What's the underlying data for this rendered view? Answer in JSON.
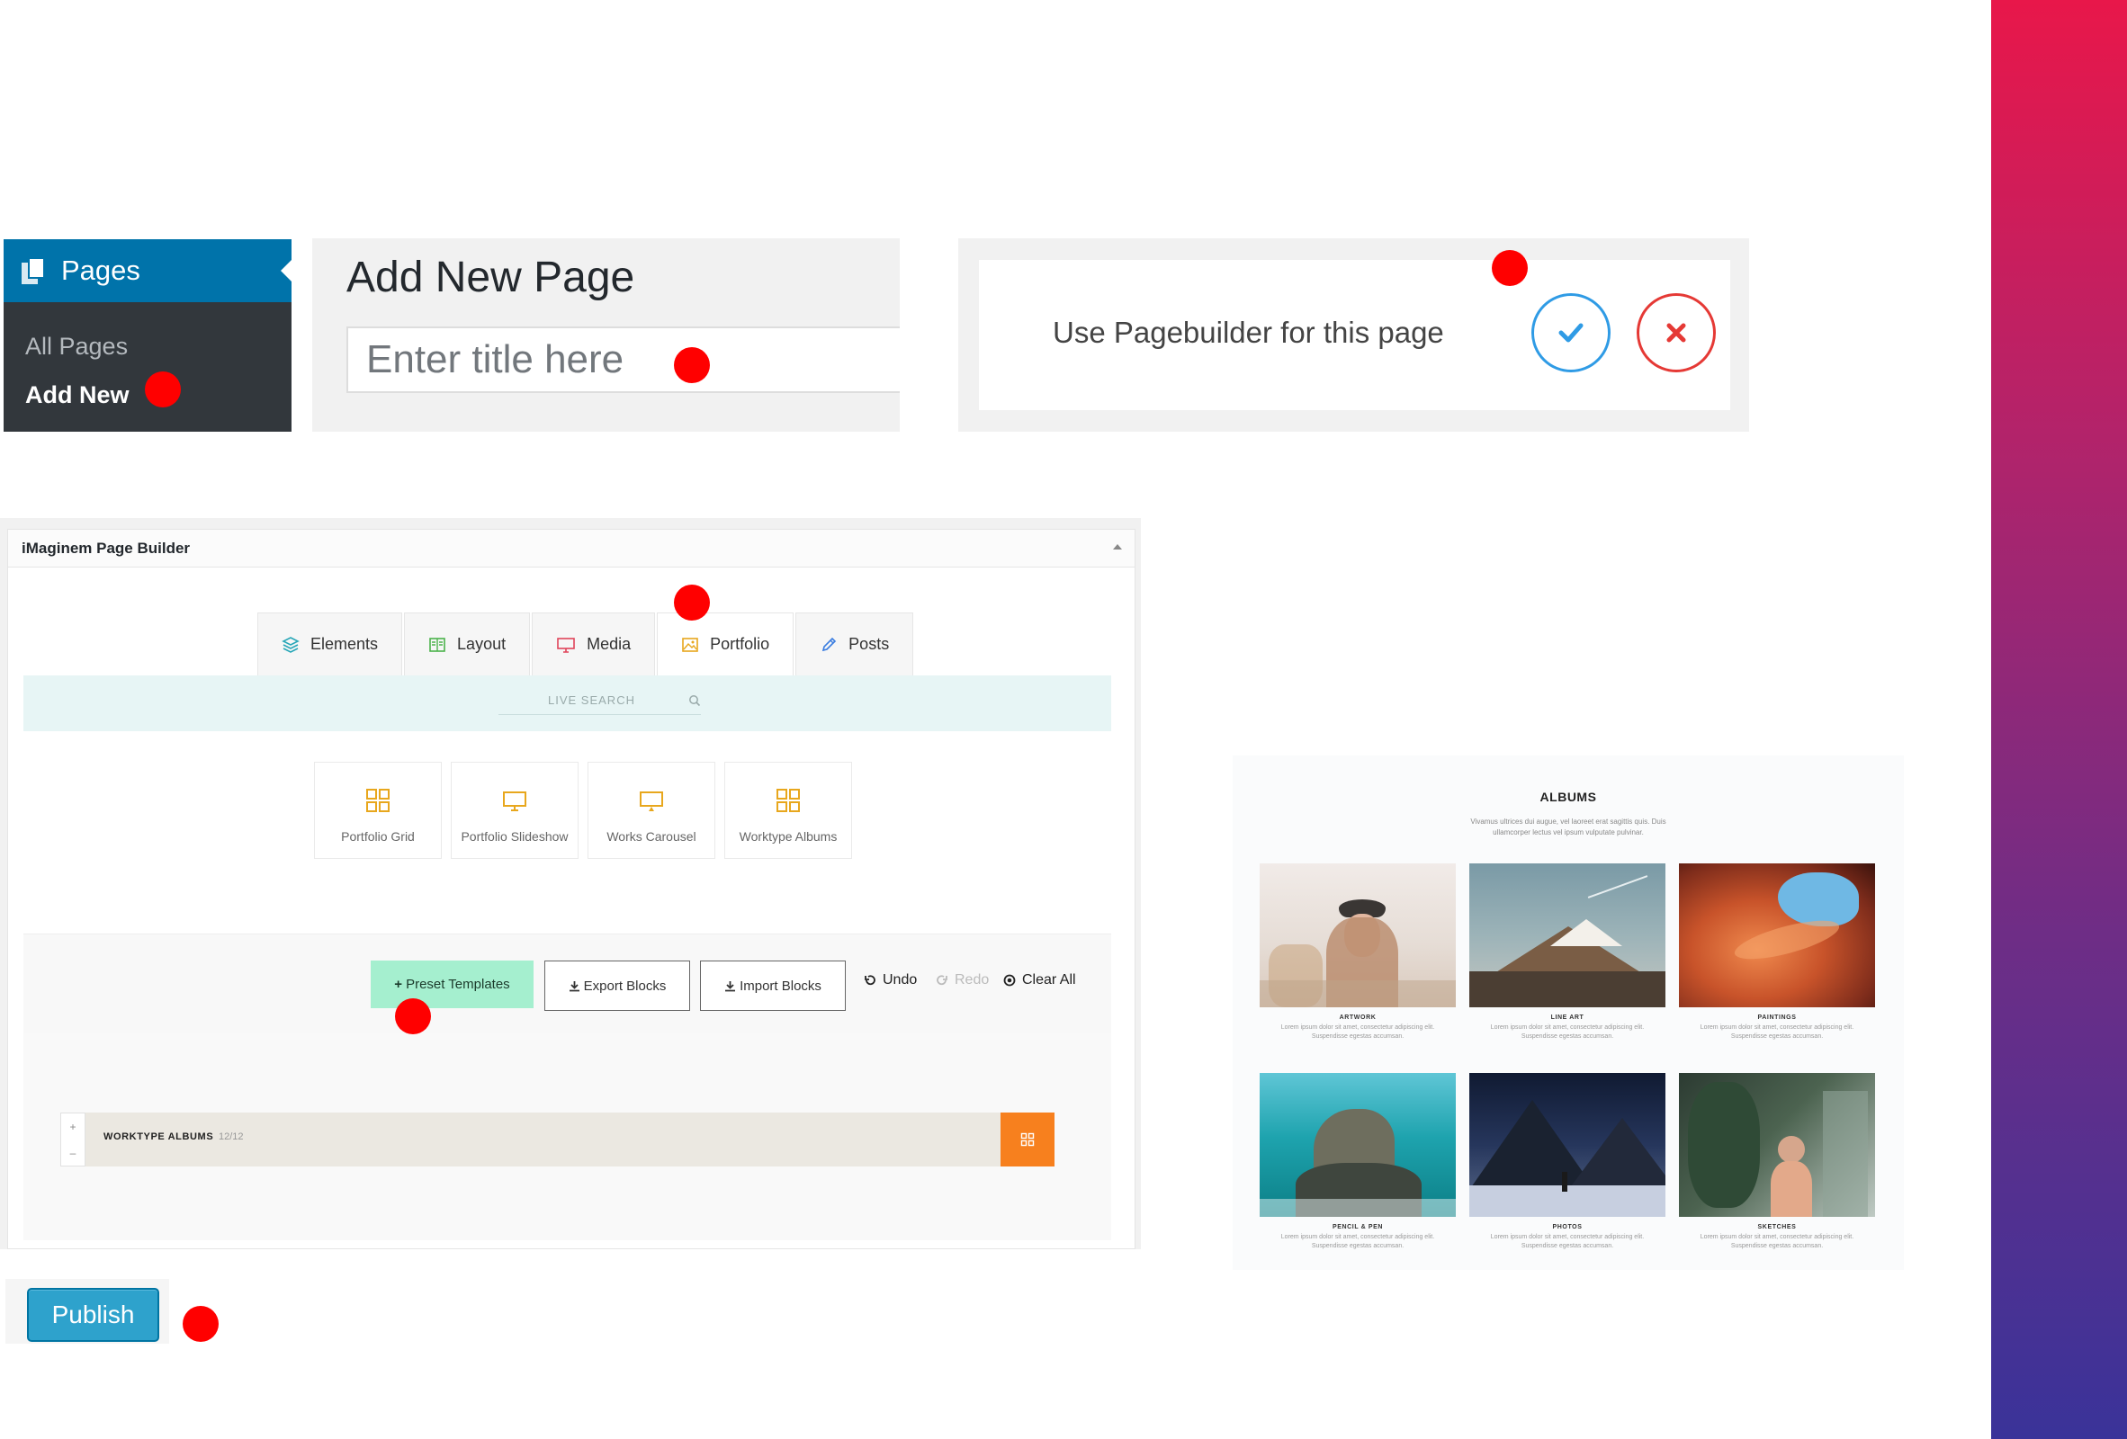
{
  "colors": {
    "accent_red": "#ff0000",
    "wp_blue": "#0073aa",
    "wp_dark": "#32373c",
    "confirm_blue": "#2f9be5",
    "cancel_red": "#e53935",
    "preset_green": "#a5efcf",
    "row_orange": "#f7801e"
  },
  "wp_menu": {
    "title": "Pages",
    "icon": "pages-icon",
    "items": [
      {
        "label": "All Pages",
        "active": false
      },
      {
        "label": "Add New",
        "active": true
      }
    ]
  },
  "add_new": {
    "heading": "Add New Page",
    "title_placeholder": "Enter title here"
  },
  "use_pagebuilder": {
    "question": "Use Pagebuilder for this page",
    "confirm_icon": "check-icon",
    "cancel_icon": "close-icon"
  },
  "page_builder": {
    "title": "iMaginem Page Builder",
    "tabs": [
      {
        "label": "Elements",
        "icon": "layers-icon"
      },
      {
        "label": "Layout",
        "icon": "book-icon"
      },
      {
        "label": "Media",
        "icon": "monitor-icon"
      },
      {
        "label": "Portfolio",
        "icon": "image-icon",
        "active": true
      },
      {
        "label": "Posts",
        "icon": "pencil-icon"
      }
    ],
    "search_placeholder": "LIVE SEARCH",
    "elements": [
      {
        "label": "Portfolio Grid",
        "icon": "grid-icon"
      },
      {
        "label": "Portfolio Slideshow",
        "icon": "monitor-icon"
      },
      {
        "label": "Works Carousel",
        "icon": "carousel-icon"
      },
      {
        "label": "Worktype Albums",
        "icon": "grid-icon"
      }
    ],
    "toolbar": {
      "preset": "Preset Templates",
      "export": "Export Blocks",
      "import": "Import Blocks",
      "undo": "Undo",
      "redo": "Redo",
      "clear": "Clear All"
    },
    "row": {
      "name": "WORKTYPE ALBUMS",
      "count": "12/12",
      "plus": "+",
      "minus": "–"
    }
  },
  "albums_preview": {
    "title": "ALBUMS",
    "description": "Vivamus ultrices dui augue, vel laoreet erat sagittis quis. Duis ullamcorper lectus vel ipsum vulputate pulvinar.",
    "items": [
      {
        "caption": "ARTWORK",
        "text": "Lorem ipsum dolor sit amet, consectetur adipiscing elit. Suspendisse egestas accumsan."
      },
      {
        "caption": "LINE ART",
        "text": "Lorem ipsum dolor sit amet, consectetur adipiscing elit. Suspendisse egestas accumsan."
      },
      {
        "caption": "PAINTINGS",
        "text": "Lorem ipsum dolor sit amet, consectetur adipiscing elit. Suspendisse egestas accumsan."
      },
      {
        "caption": "PENCIL & PEN",
        "text": "Lorem ipsum dolor sit amet, consectetur adipiscing elit. Suspendisse egestas accumsan."
      },
      {
        "caption": "PHOTOS",
        "text": "Lorem ipsum dolor sit amet, consectetur adipiscing elit. Suspendisse egestas accumsan."
      },
      {
        "caption": "SKETCHES",
        "text": "Lorem ipsum dolor sit amet, consectetur adipiscing elit. Suspendisse egestas accumsan."
      }
    ]
  },
  "publish": {
    "label": "Publish"
  }
}
